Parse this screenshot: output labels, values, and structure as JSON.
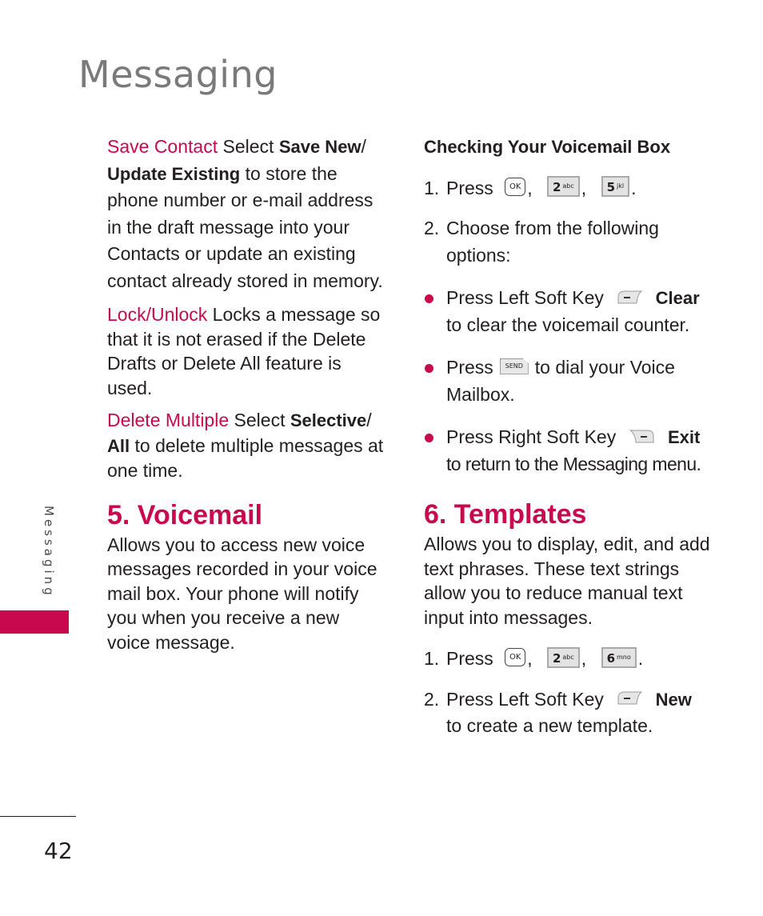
{
  "page": {
    "title": "Messaging",
    "side_tab": "Messaging",
    "page_number": "42",
    "accent_color": "#c8094d"
  },
  "left": {
    "save_contact": {
      "term": "Save Contact",
      "t1": " Select ",
      "b1": "Save New",
      "t2": "/ ",
      "b2": "Update Existing",
      "t3": " to store the phone number or e-mail address in the draft message into your Contacts or update an existing contact already stored in memory."
    },
    "lock_unlock": {
      "term": "Lock/Unlock",
      "text": " Locks a message so that it is not erased if the Delete Drafts or Delete All feature is used."
    },
    "delete_multiple": {
      "term": "Delete Multiple",
      "t1": "  Select ",
      "b1": "Selective",
      "t2": "/ ",
      "b2": "All",
      "t3": " to delete multiple messages at one time."
    },
    "voicemail": {
      "heading": "5. Voicemail",
      "body": "Allows you to access new voice messages recorded in your voice mail box. Your phone will notify you when you receive a new voice message."
    }
  },
  "right": {
    "checking": {
      "subheading": "Checking Your Voicemail Box",
      "step1": {
        "num": "1.",
        "text": "Press",
        "keys": {
          "ok": "OK",
          "k1": "2",
          "k1_sub": "abc",
          "k2": "5",
          "k2_sub": "jkl"
        },
        "comma": ",",
        "period": "."
      },
      "step2": {
        "num": "2.",
        "text": "Choose from the following options:"
      },
      "bullets": [
        {
          "pre": "Press Left Soft Key",
          "bold": "Clear",
          "post": "to clear the voicemail counter."
        },
        {
          "pre": "Press",
          "key": "SEND",
          "post": "to dial your Voice Mailbox."
        },
        {
          "pre": "Press Right Soft Key",
          "bold": "Exit",
          "post": "to return to the Messaging menu."
        }
      ]
    },
    "templates": {
      "heading": "6. Templates",
      "body": "Allows you to display, edit, and add text phrases. These text strings allow you to reduce manual text input into messages.",
      "step1": {
        "num": "1.",
        "text": "Press",
        "keys": {
          "ok": "OK",
          "k1": "2",
          "k1_sub": "abc",
          "k2": "6",
          "k2_sub": "mno"
        },
        "comma": ",",
        "period": "."
      },
      "step2": {
        "num": "2.",
        "pre": "Press Left Soft Key",
        "bold": "New",
        "post": "to create a new template."
      }
    }
  }
}
